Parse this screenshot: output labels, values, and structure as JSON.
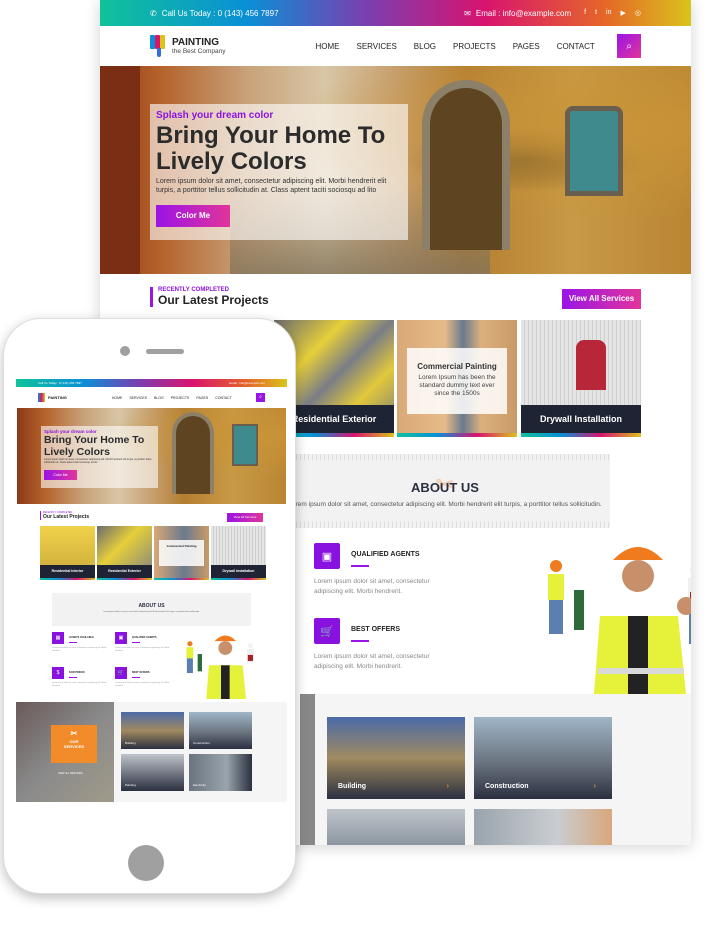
{
  "topbar": {
    "phone_label": "Call Us Today : 0 (143) 456 7897",
    "email_label": "Email : info@example.com",
    "social_icons": [
      "facebook-icon",
      "twitter-icon",
      "linkedin-icon",
      "youtube-icon",
      "instagram-icon"
    ],
    "social_glyphs": [
      "f",
      "t",
      "in",
      "▶",
      "◎"
    ]
  },
  "brand": {
    "name": "PAINTING",
    "tagline": "the Best Company"
  },
  "nav": {
    "items": [
      "HOME",
      "SERVICES",
      "BLOG",
      "PROJECTS",
      "PAGES",
      "CONTACT"
    ],
    "search_glyph": "⌕"
  },
  "hero": {
    "subtitle": "Splash your dream color",
    "title_line1": "Bring Your Home To",
    "title_line2": "Lively Colors",
    "description": "Lorem ipsum dolor sit amet, consectetur adipiscing elit. Morbi hendrerit elit turpis, a porttitor tellus sollicitudin at. Class aptent taciti sociosqu ad lito",
    "button_label": "Color Me"
  },
  "projects": {
    "kicker": "RECENTLY COMPLETED",
    "heading": "Our Latest Projects",
    "view_all_label": "View All Services",
    "items": [
      {
        "label": "Residential Interior"
      },
      {
        "label": "Residential Exterior"
      },
      {
        "label": "Commercial Painting",
        "overlay_text": "Lorem Ipsum has been the standard dummy text ever since the 1500s"
      },
      {
        "label": "Drywall Installation"
      }
    ]
  },
  "about": {
    "title": "ABOUT US",
    "description": "Lorem ipsum dolor sit amet, consectetur adipiscing elit. Morbi hendrerit elit turpis, a porttitor tellus sollicitudin.",
    "features": [
      {
        "name": "ALWAYS AVAILABLE",
        "icon": "calendar-icon",
        "glyph": "▦",
        "text": "Lorem ipsum dolor sit amet, consectetur adipiscing elit. Morbi hendrerit."
      },
      {
        "name": "QUALIFIED AGENTS",
        "icon": "briefcase-icon",
        "glyph": "▣",
        "text": "Lorem ipsum dolor sit amet, consectetur adipiscing elit. Morbi hendrerit."
      },
      {
        "name": "FAIR PRICES",
        "icon": "dollar-icon",
        "glyph": "$",
        "text": "Lorem ipsum dolor sit amet, consectetur adipiscing elit. Morbi hendrerit."
      },
      {
        "name": "BEST OFFERS",
        "icon": "cart-icon",
        "glyph": "🛒",
        "text": "Lorem ipsum dolor sit amet, consectetur adipiscing elit. Morbi hendrerit."
      }
    ]
  },
  "services": {
    "heading_line1": "OUR",
    "heading_line2": "SERVICES",
    "view_all_label": "VIEW ALL SERVICES",
    "items": [
      {
        "label": "Building"
      },
      {
        "label": "Construction"
      },
      {
        "label": "Painting"
      },
      {
        "label": "Electricity"
      }
    ],
    "arrow_glyph": "›"
  },
  "colors": {
    "accent_purple": "#9b14e6",
    "accent_pink": "#e1349b",
    "services_orange": "#f28c2a",
    "card_dark": "#1e2433"
  }
}
